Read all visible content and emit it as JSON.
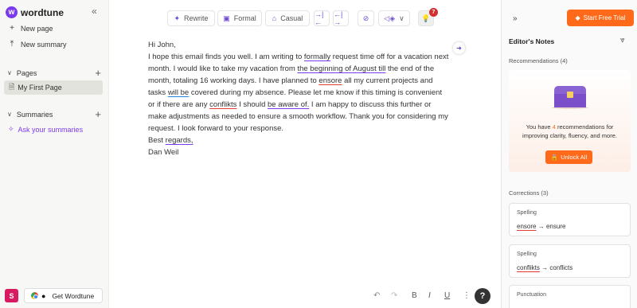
{
  "sidebar": {
    "brand": "wordtune",
    "new_page": "New page",
    "new_summary": "New summary",
    "pages_label": "Pages",
    "page_item": "My First Page",
    "summaries_label": "Summaries",
    "ask_summaries": "Ask your summaries",
    "avatar_initial": "S",
    "get_wordtune": "Get Wordtune"
  },
  "toolbar": {
    "rewrite": "Rewrite",
    "formal": "Formal",
    "casual": "Casual",
    "badge_count": "7"
  },
  "document": {
    "greeting": "Hi John,",
    "body": [
      {
        "t": "I hope this email finds you well. I am writing to "
      },
      {
        "t": "formally",
        "u": "purple"
      },
      {
        "t": " request time off for a vacation next month. I would like to take my vacation from "
      },
      {
        "t": "the beginning of August till",
        "u": "purple"
      },
      {
        "t": " the end of the month, totaling 16 working days. I have planned to "
      },
      {
        "t": "ensore",
        "u": "red"
      },
      {
        "t": " all my current projects and tasks "
      },
      {
        "t": "will be",
        "u": "blue"
      },
      {
        "t": " covered during my absence. Please let me know if this timing is convenient or if there are any "
      },
      {
        "t": "conflikts",
        "u": "red"
      },
      {
        "t": " I should "
      },
      {
        "t": "be aware of.",
        "u": "purple"
      },
      {
        "t": " I am happy to discuss this further or make adjustments as needed to ensure a smooth workflow. Thank you for considering my request. I look forward to your response."
      }
    ],
    "closing_prefix": "Best ",
    "closing_word": "regards,",
    "signature": "Dan Weil"
  },
  "bottom_toolbar": {
    "bold": "B",
    "italic": "I",
    "underline": "U",
    "help": "?"
  },
  "right_panel": {
    "start_trial": "Start Free Trial",
    "title": "Editor's Notes",
    "recommendations_label": "Recommendations (4)",
    "rec_text_before": "You have ",
    "rec_count": "4",
    "rec_text_after": " recommendations for improving clarity, fluency, and more.",
    "unlock_all": "Unlock All",
    "corrections_label": "Corrections (3)",
    "corrections": [
      {
        "type": "Spelling",
        "wrong": "ensore",
        "arrow": "→",
        "right": "ensure"
      },
      {
        "type": "Spelling",
        "wrong": "conflikts",
        "arrow": "→",
        "right": "conflicts"
      },
      {
        "type": "Punctuation",
        "wrong": "",
        "arrow": "",
        "right": ""
      }
    ]
  },
  "colors": {
    "accent": "#7c3aed",
    "orange": "#ff6a1a",
    "error_underline": "#e53935"
  }
}
